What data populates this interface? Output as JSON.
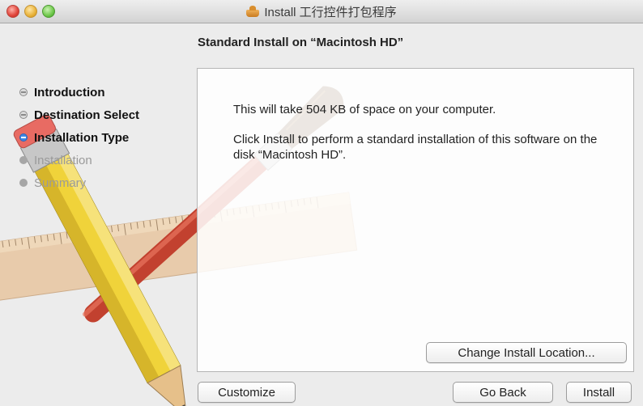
{
  "window": {
    "title": "Install 工行控件打包程序",
    "app_icon": "package-box-icon"
  },
  "header": {
    "title": "Standard Install on “Macintosh HD”"
  },
  "sidebar": {
    "steps": [
      {
        "label": "Introduction",
        "state": "done"
      },
      {
        "label": "Destination Select",
        "state": "done"
      },
      {
        "label": "Installation Type",
        "state": "current"
      },
      {
        "label": "Installation",
        "state": "future"
      },
      {
        "label": "Summary",
        "state": "future"
      }
    ]
  },
  "content": {
    "line1": "This will take 504 KB of space on your computer.",
    "line2": "Click Install to perform a standard installation of this software on the disk “Macintosh HD”."
  },
  "buttons": {
    "change_location": "Change Install Location...",
    "customize": "Customize",
    "go_back": "Go Back",
    "install": "Install"
  },
  "colors": {
    "current_step_bullet": "#3d86e6",
    "window_bg": "#ececec"
  }
}
